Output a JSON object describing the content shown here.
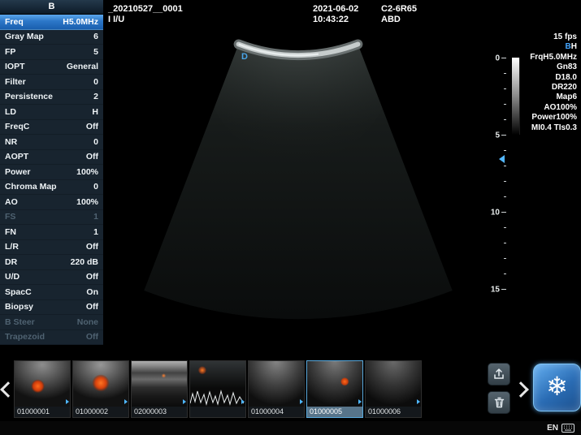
{
  "sidebar": {
    "title": "B",
    "params": [
      {
        "label": "Freq",
        "value": "H5.0MHz",
        "state": "selected"
      },
      {
        "label": "Gray Map",
        "value": "6",
        "state": "normal"
      },
      {
        "label": "FP",
        "value": "5",
        "state": "normal"
      },
      {
        "label": "IOPT",
        "value": "General",
        "state": "normal"
      },
      {
        "label": "Filter",
        "value": "0",
        "state": "normal"
      },
      {
        "label": "Persistence",
        "value": "2",
        "state": "normal"
      },
      {
        "label": "LD",
        "value": "H",
        "state": "normal"
      },
      {
        "label": "FreqC",
        "value": "Off",
        "state": "normal"
      },
      {
        "label": "NR",
        "value": "0",
        "state": "normal"
      },
      {
        "label": "AOPT",
        "value": "Off",
        "state": "normal"
      },
      {
        "label": "Power",
        "value": "100%",
        "state": "normal"
      },
      {
        "label": "Chroma Map",
        "value": "0",
        "state": "normal"
      },
      {
        "label": "AO",
        "value": "100%",
        "state": "normal"
      },
      {
        "label": "FS",
        "value": "1",
        "state": "dimmed"
      },
      {
        "label": "FN",
        "value": "1",
        "state": "normal"
      },
      {
        "label": "L/R",
        "value": "Off",
        "state": "normal"
      },
      {
        "label": "DR",
        "value": "220 dB",
        "state": "normal"
      },
      {
        "label": "U/D",
        "value": "Off",
        "state": "normal"
      },
      {
        "label": "SpacC",
        "value": "On",
        "state": "normal"
      },
      {
        "label": "Biopsy",
        "value": "Off",
        "state": "normal"
      },
      {
        "label": "B Steer",
        "value": "None",
        "state": "dimmed"
      },
      {
        "label": "Trapezoid",
        "value": "Off",
        "state": "dimmed"
      }
    ]
  },
  "topbar": {
    "exam_id": "_20210527__0001",
    "patient": "I I/U",
    "date": "2021-06-02",
    "time": "10:43:22",
    "probe": "C2-6R65",
    "preset": "ABD"
  },
  "image_info": {
    "fps": "15 fps",
    "mode_b": "B",
    "mode_h": "H",
    "lines": [
      "FrqH5.0MHz",
      "Gn83",
      "D18.0",
      "DR220",
      "Map6",
      "AO100%",
      "Power100%",
      "MI0.4 TIs0.3"
    ]
  },
  "image_area": {
    "orientation_marker": "D",
    "focus_marker_icon": "chevron-left"
  },
  "depth_ruler": {
    "marks": [
      "0",
      "5",
      "10",
      "15"
    ]
  },
  "thumbnails": {
    "prev_icon": "chevron-left",
    "next_icon": "chevron-right",
    "items": [
      {
        "label": "01000001",
        "type": "color",
        "selected": false
      },
      {
        "label": "01000002",
        "type": "color2",
        "selected": false
      },
      {
        "label": "02000003",
        "type": "linear",
        "selected": false
      },
      {
        "label": "",
        "type": "pw",
        "selected": false
      },
      {
        "label": "01000004",
        "type": "b",
        "selected": false
      },
      {
        "label": "01000005",
        "type": "colorsm",
        "selected": true
      },
      {
        "label": "01000006",
        "type": "b2",
        "selected": false
      }
    ]
  },
  "controls": {
    "freeze_icon": "❄",
    "export_icon": "export-arrow",
    "delete_icon": "trash"
  },
  "statusbar": {
    "lang": "EN",
    "icon": "keyboard-icon"
  },
  "colors": {
    "accent_blue": "#45a6ff",
    "selected_row_blue": "#2c77c8",
    "freeze_blue": "#2a6cb4",
    "doppler_orange": "#e05a18"
  }
}
